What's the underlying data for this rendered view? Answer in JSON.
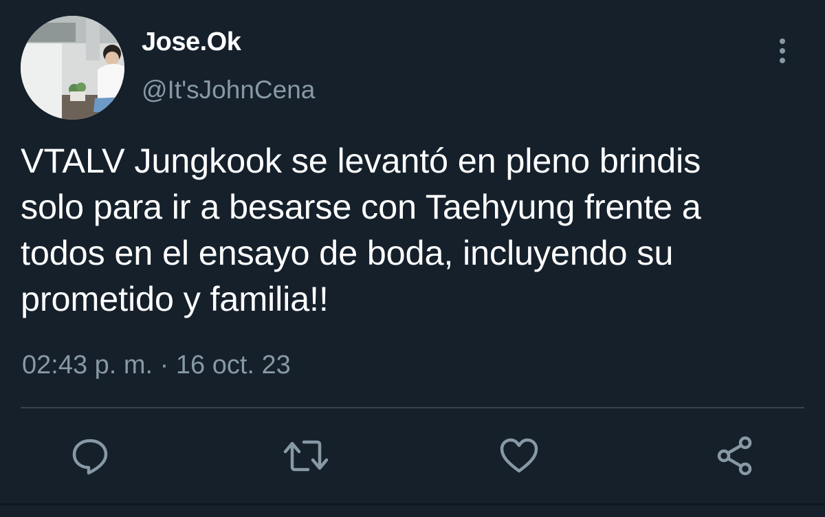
{
  "user": {
    "display_name": "Jose.Ok",
    "handle": "@It'sJohnCena"
  },
  "tweet": {
    "text": "VTALV Jungkook se levantó en pleno brindis\nsolo para ir a besarse con Taehyung frente a\ntodos en el ensayo de boda, incluyendo su\nprometido y familia!!",
    "timestamp": "02:43 p. m. · 16 oct. 23"
  },
  "actions": {
    "reply_icon": "reply-icon",
    "retweet_icon": "retweet-icon",
    "like_icon": "heart-icon",
    "share_icon": "share-icon"
  },
  "colors": {
    "background": "#15202b",
    "text_primary": "#ffffff",
    "text_secondary": "#8899a6",
    "divider": "#38444d",
    "icon": "#8899a6"
  }
}
